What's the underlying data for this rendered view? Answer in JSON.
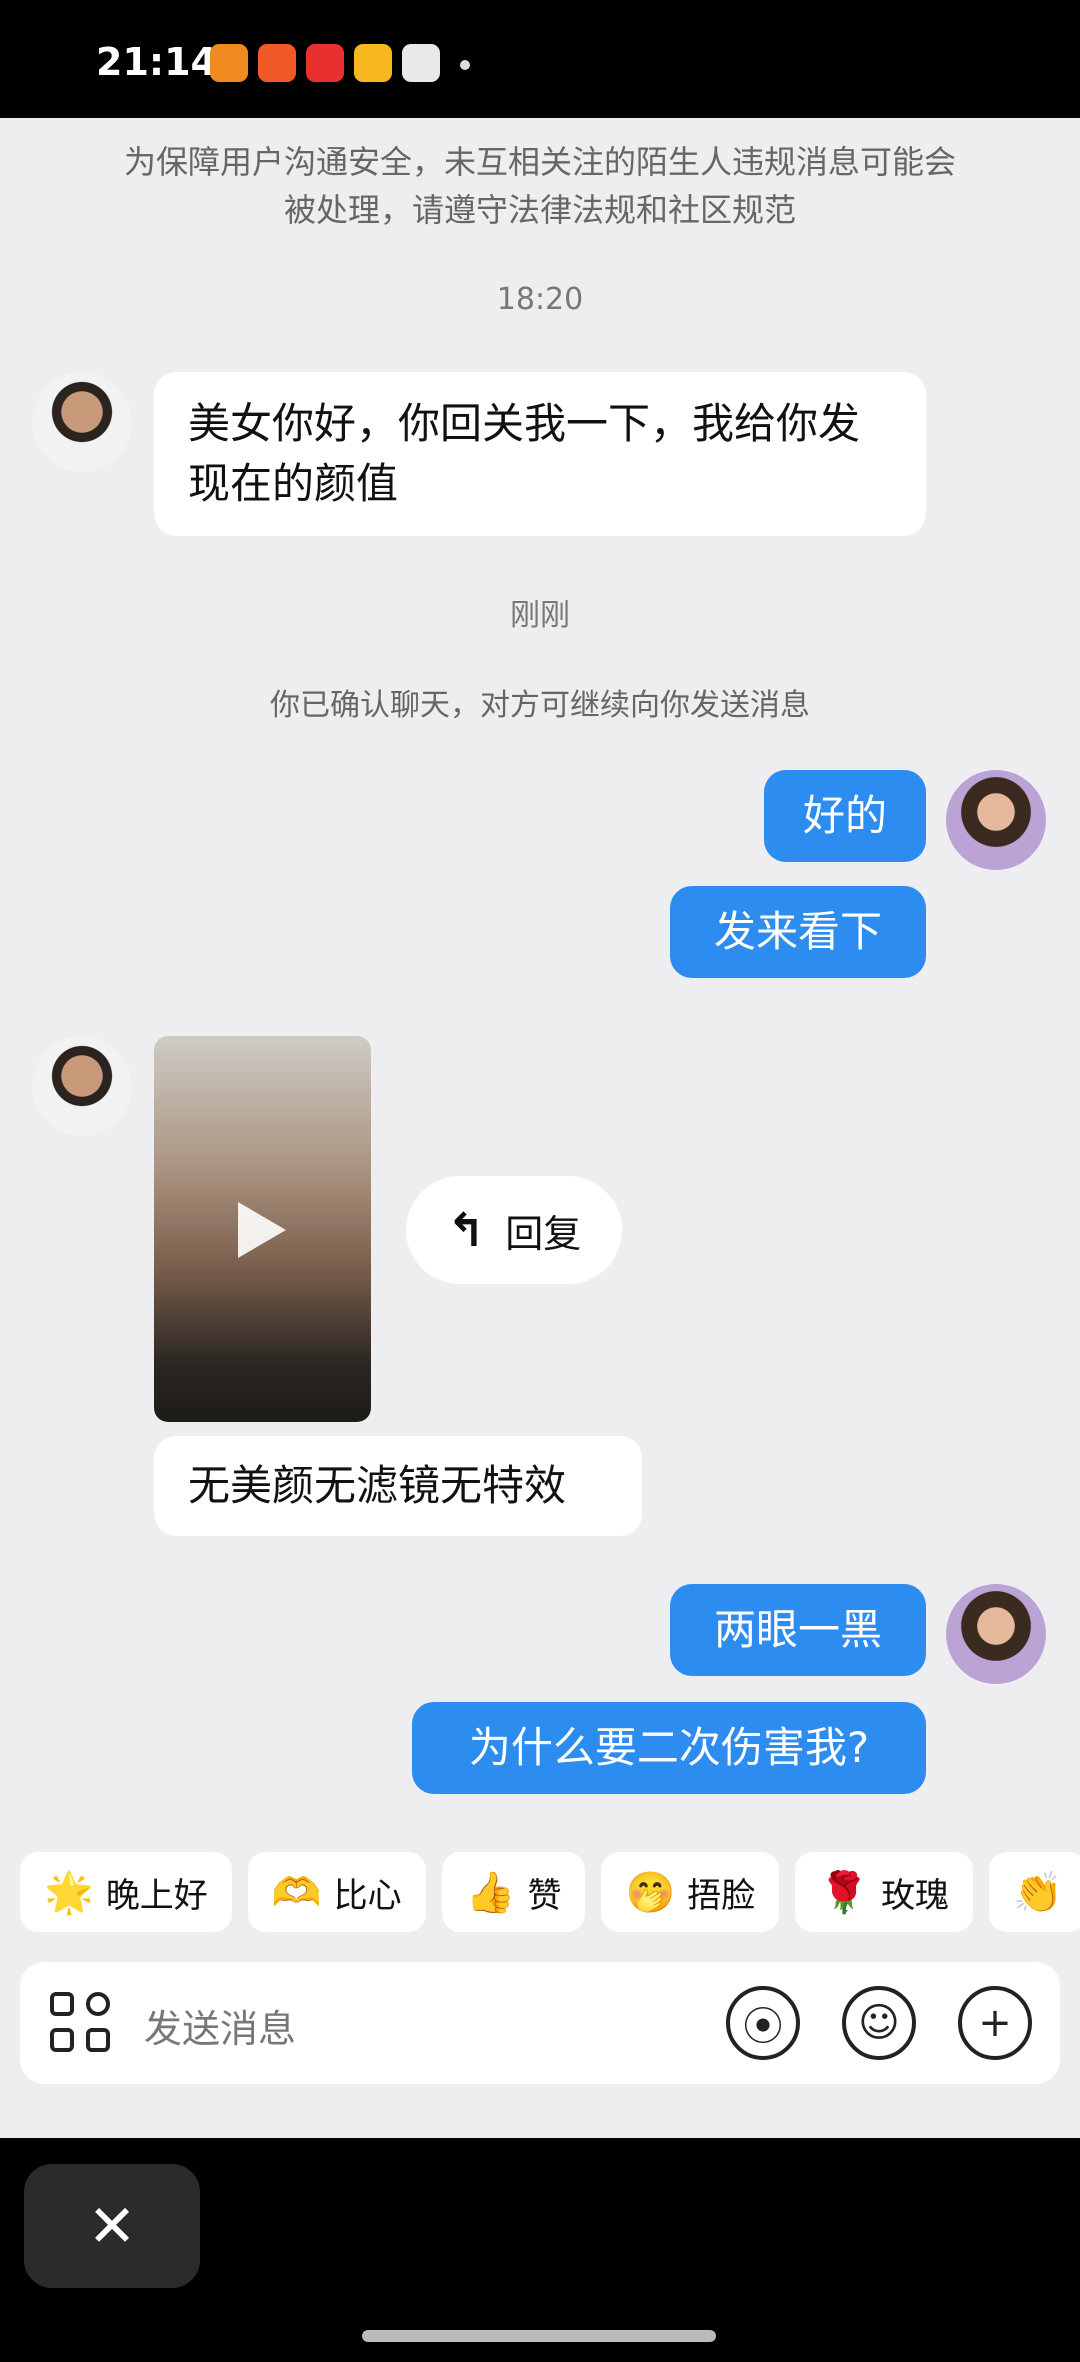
{
  "status": {
    "time": "21:14"
  },
  "notice": "为保障用户沟通安全，未互相关注的陌生人违规消息可能会被处理，请遵守法律法规和社区规范",
  "timestamps": {
    "first": "18:20",
    "second": "刚刚"
  },
  "system_message": "你已确认聊天，对方可继续向你发送消息",
  "messages": {
    "m1": "美女你好，你回关我一下，我给你发现在的颜值",
    "m2": "好的",
    "m3": "发来看下",
    "m4": "无美颜无滤镜无特效",
    "m5": "两眼一黑",
    "m6": "为什么要二次伤害我?"
  },
  "reply_label": "回复",
  "quick_replies": [
    {
      "emoji": "🌟",
      "label": "晚上好"
    },
    {
      "emoji": "🫶",
      "label": "比心"
    },
    {
      "emoji": "👍",
      "label": "赞"
    },
    {
      "emoji": "🤭",
      "label": "捂脸"
    },
    {
      "emoji": "🌹",
      "label": "玫瑰"
    },
    {
      "emoji": "👏",
      "label": ""
    }
  ],
  "input": {
    "placeholder": "发送消息"
  },
  "close_label": "✕",
  "colors": {
    "outgoing_bubble": "#2d8cf0",
    "chat_bg": "#eeeef0"
  }
}
